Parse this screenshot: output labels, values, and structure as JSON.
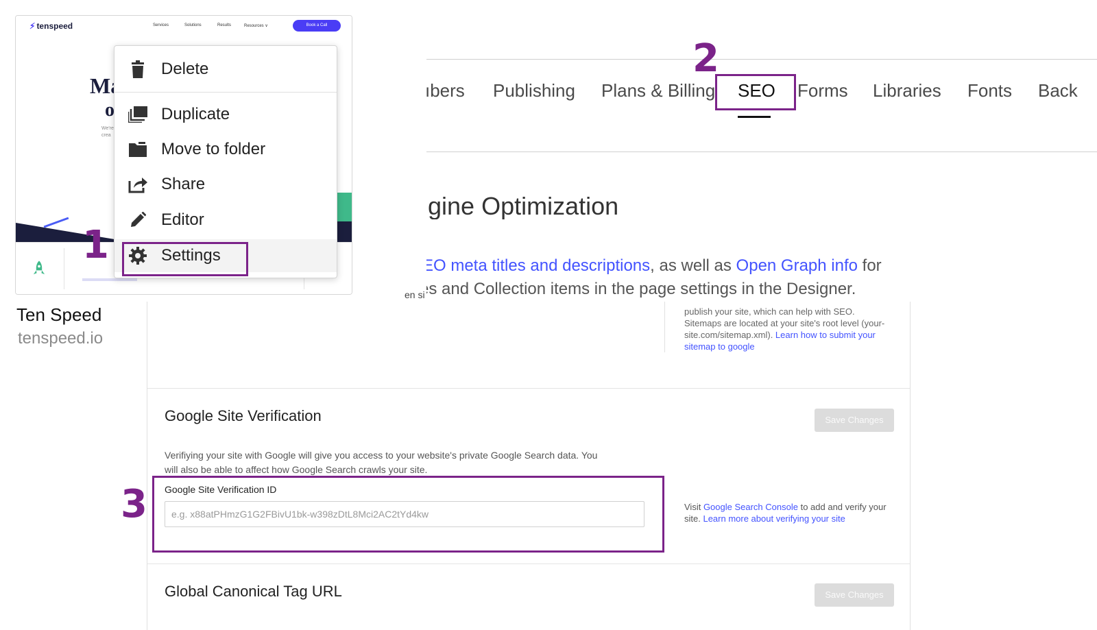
{
  "card": {
    "thumbnail": {
      "logo": "tenspeed",
      "nav_links": [
        "Services",
        "Solutions",
        "Results",
        "Resources ∨"
      ],
      "cta": "Book a Call",
      "hero_line1": "Ma",
      "hero_line2": "o",
      "hero_small": "We're\ncrea"
    },
    "site_name": "Ten Speed",
    "site_domain": "tenspeed.io"
  },
  "context_menu": {
    "items": [
      {
        "label": "Delete",
        "icon": "trash-icon"
      },
      {
        "label": "Duplicate",
        "icon": "duplicate-icon"
      },
      {
        "label": "Move to folder",
        "icon": "folder-icon"
      },
      {
        "label": "Share",
        "icon": "share-icon"
      },
      {
        "label": "Editor",
        "icon": "pencil-icon"
      },
      {
        "label": "Settings",
        "icon": "gear-icon",
        "highlighted": true
      }
    ]
  },
  "steps": {
    "one": "1",
    "two": "2",
    "three": "3"
  },
  "settings_tabs": {
    "tabs": [
      "ıbers",
      "Publishing",
      "Plans & Billing",
      "SEO",
      "Forms",
      "Libraries",
      "Fonts",
      "Back"
    ],
    "active": "SEO"
  },
  "seo_section": {
    "heading": "ıgine Optimization",
    "desc_link1": "EO meta titles and descriptions",
    "desc_mid": ", as well as ",
    "desc_link2": "Open Graph info",
    "desc_end": " for",
    "desc_line2": "es and Collection items in the page settings in the Designer.",
    "stray": "en si"
  },
  "sitemap_help": {
    "text": "publish your site, which can help with SEO. Sitemaps are located at your site's root level (your-site.com/sitemap.xml). ",
    "link": "Learn how to submit your sitemap to google"
  },
  "google_verification": {
    "title": "Google Site Verification",
    "save_label": "Save Changes",
    "description": "Verifiying your site with Google will give you access to your website's private Google Search data. You will also be able to affect how Google Search crawls your site.",
    "field_label": "Google Site Verification ID",
    "placeholder": "e.g. x88atPHmzG1G2FBivU1bk-w398zDtL8Mci2AC2tYd4kw",
    "value": "",
    "help_prefix": "Visit ",
    "help_link1": "Google Search Console",
    "help_mid": " to add and verify your site. ",
    "help_link2": "Learn more about verifying your site"
  },
  "canonical": {
    "title": "Global Canonical Tag URL",
    "save_label": "Save Changes"
  },
  "colors": {
    "highlight": "#7b2389",
    "link": "#4353ff",
    "brand": "#4a3df5"
  }
}
